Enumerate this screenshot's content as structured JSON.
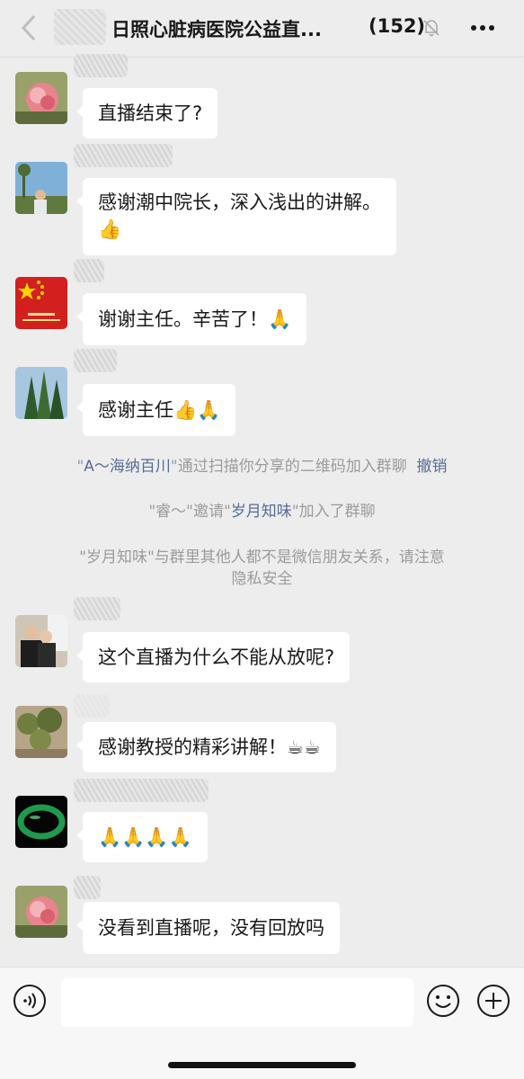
{
  "header": {
    "title": "日照心脏病医院公益直...",
    "member_count": "(152)",
    "back_icon": "chevron-left-icon",
    "mute_icon": "bell-muted-icon",
    "more_icon": "ellipsis-icon"
  },
  "messages": [
    {
      "text": "直播结束了?"
    },
    {
      "line1": "感谢潮中院长，深入浅出的讲解。",
      "line2": "👍"
    },
    {
      "text": "谢谢主任。辛苦了！",
      "emoji": "🙏"
    },
    {
      "text": "感谢主任",
      "emoji": "👍🙏"
    },
    {
      "text": "这个直播为什么不能从放呢?"
    },
    {
      "text": "感谢教授的精彩讲解！",
      "emoji": "☕☕"
    },
    {
      "emoji": "🙏🙏🙏🙏"
    },
    {
      "text": "没看到直播呢，没有回放吗"
    }
  ],
  "system": {
    "notice1": {
      "q1": "\"",
      "name": "A～海纳百川",
      "rest": "\"通过扫描你分享的二维码加入群聊",
      "revoke": "撤销"
    },
    "notice2": {
      "pre": "\"睿～\"邀请\"",
      "name": "岁月知味",
      "rest": "\"加入了群聊"
    },
    "notice3": {
      "line1": "\"岁月知味\"与群里其他人都不是微信朋友关系，请注意",
      "line2": "隐私安全"
    }
  },
  "inputbar": {
    "voice_icon": "voice-icon",
    "emoji_icon": "emoji-icon",
    "plus_icon": "plus-icon",
    "input_value": ""
  },
  "colors": {
    "background": "#ededed",
    "bubble": "#ffffff",
    "link": "#576b95",
    "system_text": "#9b9b9b"
  }
}
